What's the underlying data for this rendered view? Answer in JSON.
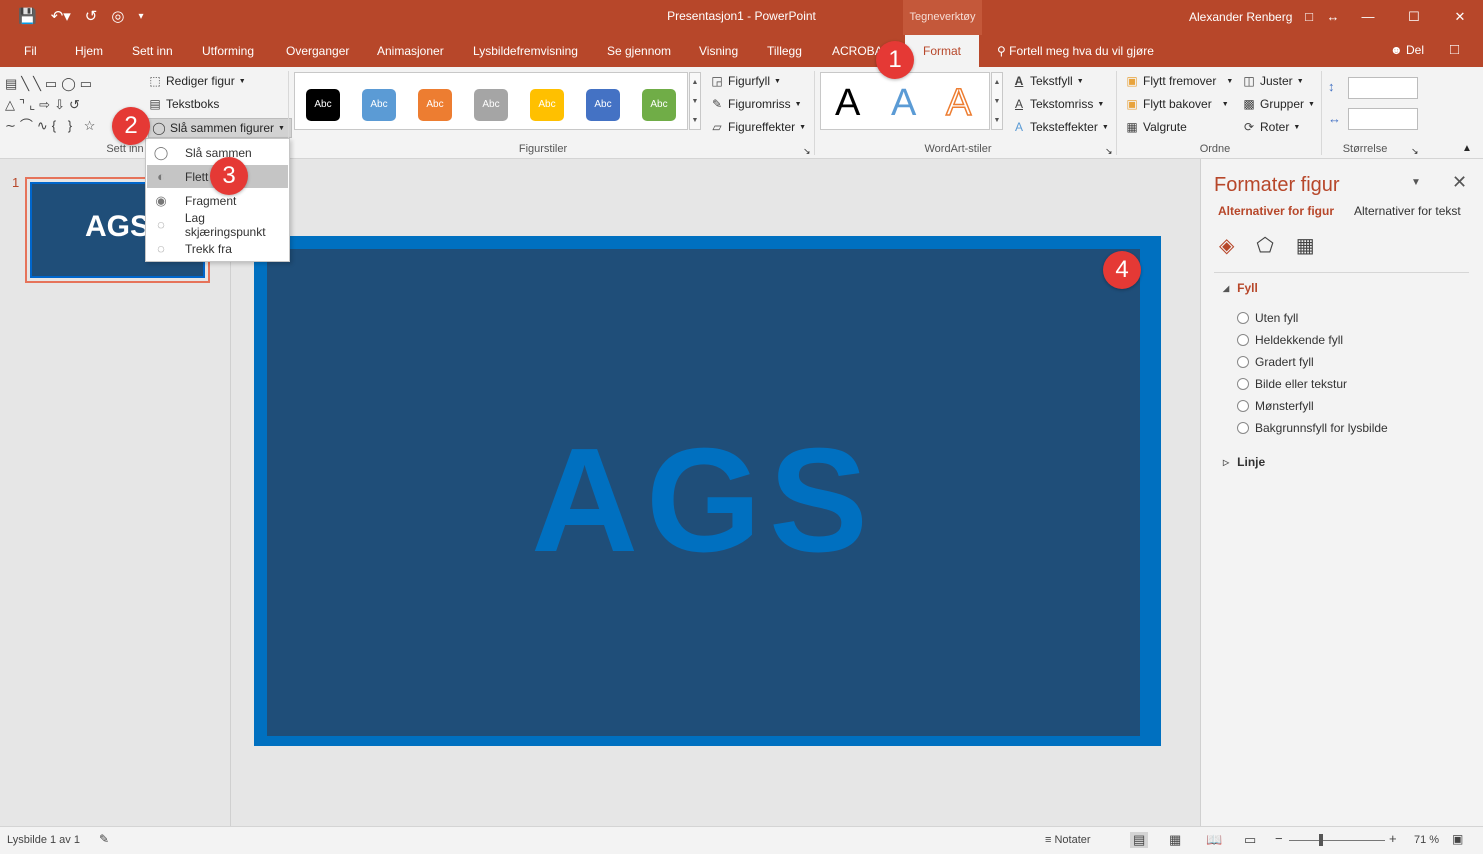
{
  "titlebar": {
    "doc_title": "Presentasjon1  -  PowerPoint",
    "context_tab": "Tegneverktøy",
    "user": "Alexander Renberg"
  },
  "tabs": [
    "Fil",
    "Hjem",
    "Sett inn",
    "Utforming",
    "Overganger",
    "Animasjoner",
    "Lysbildefremvisning",
    "Se gjennom",
    "Visning",
    "Tillegg",
    "ACROBAT"
  ],
  "active_tab": "Format",
  "tell_me": "Fortell meg hva du vil gjøre",
  "share": "Del",
  "ribbon": {
    "insert_shapes": {
      "label": "Sett inn",
      "edit_shape": "Rediger figur",
      "textbox": "Tekstboks",
      "merge_shapes": "Slå sammen figurer"
    },
    "shape_styles": {
      "label": "Figurstiler",
      "swatch_text": "Abc",
      "swatch_colors": [
        "#000000",
        "#5b9bd5",
        "#ed7d31",
        "#a5a5a5",
        "#ffc000",
        "#4472c4",
        "#70ad47"
      ],
      "fill": "Figurfyll",
      "outline": "Figuromriss",
      "effects": "Figureffekter"
    },
    "wordart": {
      "label": "WordArt-stiler",
      "letter": "A",
      "text_fill": "Tekstfyll",
      "text_outline": "Tekstomriss",
      "text_effects": "Teksteffekter"
    },
    "arrange": {
      "label": "Ordne",
      "bring_forward": "Flytt fremover",
      "send_backward": "Flytt bakover",
      "selection_pane": "Valgrute",
      "align": "Juster",
      "group": "Grupper",
      "rotate": "Roter"
    },
    "size": {
      "label": "Størrelse"
    }
  },
  "merge_menu": {
    "items": [
      "Slå sammen",
      "Flett",
      "Fragment",
      "Lag skjæringspunkt",
      "Trekk fra"
    ],
    "highlighted_index": 1
  },
  "thumbnail": {
    "number": "1",
    "text": "AGS"
  },
  "slide": {
    "text": "AGS"
  },
  "format_pane": {
    "title": "Formater figur",
    "tab_shape": "Alternativer for figur",
    "tab_text": "Alternativer for tekst",
    "fill_section": "Fyll",
    "fill_options": [
      "Uten fyll",
      "Heldekkende fyll",
      "Gradert fyll",
      "Bilde eller tekstur",
      "Mønsterfyll",
      "Bakgrunnsfyll for lysbilde"
    ],
    "line_section": "Linje"
  },
  "statusbar": {
    "slide_info": "Lysbilde 1 av 1",
    "notes": "Notater",
    "zoom": "71 %"
  },
  "callouts": [
    "1",
    "2",
    "3",
    "4"
  ],
  "colors": {
    "accent": "#b7472a",
    "slide_bg": "#1f4e79",
    "slide_border": "#0070c0",
    "callout": "#e53935"
  }
}
